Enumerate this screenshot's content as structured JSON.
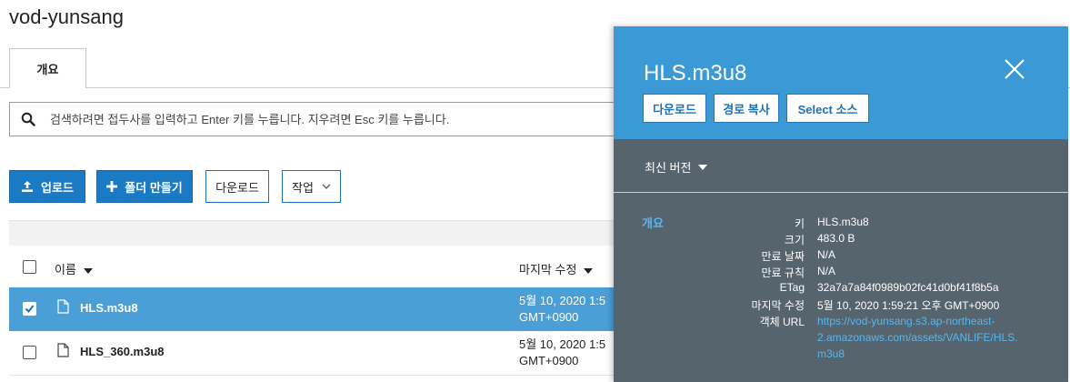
{
  "bucket": {
    "title": "vod-yunsang"
  },
  "tabs": [
    {
      "label": "개요"
    }
  ],
  "search": {
    "placeholder": "검색하려면 접두사를 입력하고 Enter 키를 누릅니다. 지우려면 Esc 키를 누릅니다."
  },
  "toolbar": {
    "upload_label": "업로드",
    "create_folder_label": "폴더 만들기",
    "download_label": "다운로드",
    "actions_label": "작업"
  },
  "table": {
    "columns": {
      "name": "이름",
      "modified": "마지막 수정"
    },
    "rows": [
      {
        "name": "HLS.m3u8",
        "date_line1": "5월 10, 2020 1:5",
        "date_line2": "GMT+0900",
        "checked": true
      },
      {
        "name": "HLS_360.m3u8",
        "date_line1": "5월 10, 2020 1:5",
        "date_line2": "GMT+0900",
        "checked": false
      }
    ]
  },
  "panel": {
    "title": "HLS.m3u8",
    "buttons": {
      "download": "다운로드",
      "copy_path": "경로 복사",
      "select_source": "Select 소스"
    },
    "version_label": "최신 버전",
    "section_label": "개요",
    "properties": {
      "key_label": "키",
      "key_value": "HLS.m3u8",
      "size_label": "크기",
      "size_value": "483.0 B",
      "expiry_date_label": "만료 날짜",
      "expiry_date_value": "N/A",
      "expiry_rule_label": "만료 규칙",
      "expiry_rule_value": "N/A",
      "etag_label": "ETag",
      "etag_value": "32a7a7a84f0989b02fc41d0bf41f8b5a",
      "modified_label": "마지막 수정",
      "modified_value": "5월 10, 2020 1:59:21 오후 GMT+0900",
      "url_label": "객체 URL",
      "url_line1": "https://vod-yunsang.s3.ap-northeast-",
      "url_line2": "2.amazonaws.com/assets/VANLIFE/HLS.",
      "url_line3": "m3u8"
    }
  },
  "colors": {
    "primary": "#1a7ac4",
    "selected_row": "#4a9fd6",
    "panel_header": "#3b99d6",
    "panel_body": "#56646e",
    "panel_link": "#57b6f0"
  },
  "icons": [
    "search-icon",
    "upload-icon",
    "plus-icon",
    "chevron-down-icon",
    "caret-down-icon",
    "file-icon",
    "checkbox-checked-icon",
    "close-icon"
  ]
}
